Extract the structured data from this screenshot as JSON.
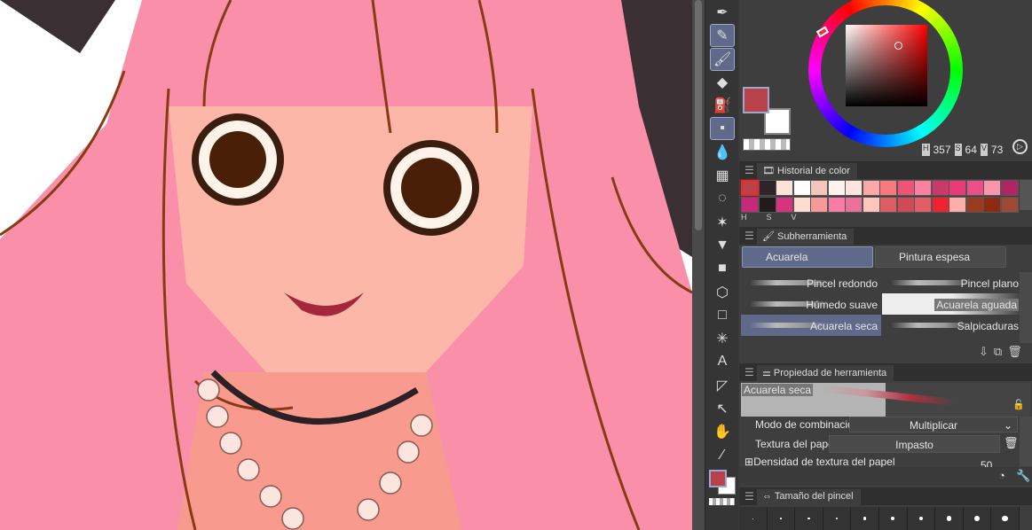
{
  "color": {
    "main_color": "#b8414a",
    "sub_color": "#ffffff",
    "hsv": {
      "h": "357",
      "s": "64",
      "v": "73"
    },
    "h_label": "H",
    "s_label": "S",
    "v_label": "V"
  },
  "history": {
    "title": "Historial de color",
    "row1": [
      "#b8414a",
      "#2e2528",
      "#fde2d9",
      "#ffffff",
      "#f4c5bb",
      "#fff3f0",
      "#fde4dc",
      "#f9a9a6",
      "#f87a7e",
      "#ec5577",
      "#f882a0",
      "#c93a6c",
      "#e73a77",
      "#ea5088",
      "#f996ad",
      "#b02664"
    ],
    "row2": [
      "#c8277a",
      "#231a1e",
      "#d8337e",
      "#fddcd0",
      "#f99898",
      "#f97ba6",
      "#ea7199",
      "#fdc5bc",
      "#de5d63",
      "#d04a55",
      "#e35d67",
      "#ef2230",
      "#fdadaa",
      "#9a3b21",
      "#8c2a12",
      "#9d4a35"
    ]
  },
  "subtool": {
    "title": "Subherramienta",
    "groups": [
      "Acuarela",
      "Pintura espesa"
    ],
    "brushes": [
      "Pincel redondo",
      "Pincel plano",
      "Húmedo suave",
      "Acuarela aguada",
      "Acuarela seca",
      "Salpicaduras"
    ]
  },
  "toolprop": {
    "title": "Propiedad de herramienta",
    "preview_name": "Acuarela seca",
    "blend_label": "Modo de combinación",
    "blend_value": "Multiplicar",
    "texture_label": "Textura del papel",
    "texture_value": "Impasto",
    "density_label": "Densidad de textura del papel",
    "density_value": "50"
  },
  "brushsize": {
    "title": "Tamaño del pincel"
  }
}
